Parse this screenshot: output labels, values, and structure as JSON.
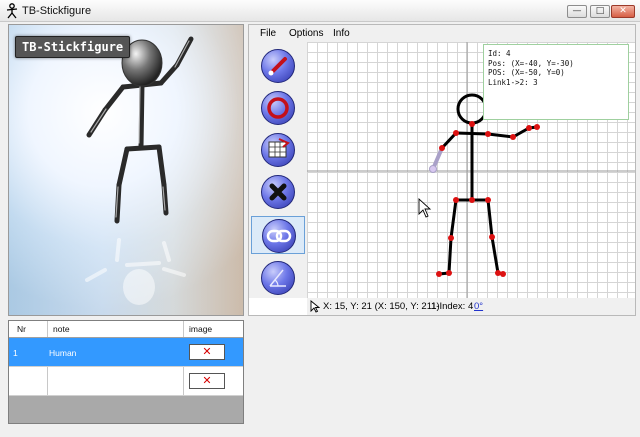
{
  "window": {
    "title": "TB-Stickfigure",
    "minimize_glyph": "—",
    "maximize_glyph": "□",
    "close_glyph": "✕"
  },
  "photo": {
    "label": "TB-Stickfigure"
  },
  "menu": [
    "File",
    "Options",
    "Info"
  ],
  "tools": [
    {
      "name": "line-tool-icon"
    },
    {
      "name": "circle-tool-icon"
    },
    {
      "name": "grid-copy-tool-icon"
    },
    {
      "name": "delete-tool-icon"
    },
    {
      "name": "link-tool-icon",
      "active": true
    },
    {
      "name": "angle-tool-icon"
    }
  ],
  "info_box": {
    "line1": "Id: 4",
    "line2": "Pos: (X=-40, Y=-30)",
    "line3": "POS: (X=-50, Y=0)",
    "line4": "Link1->2: 3"
  },
  "status": {
    "coords": "X: 15, Y: 21 (X: 150, Y: 211)",
    "index": "1-Index: 4",
    "angle": "0°"
  },
  "table": {
    "headers": [
      "Nr",
      "note",
      "image"
    ],
    "rows": [
      {
        "nr": "1",
        "note": "Human",
        "image": "✕",
        "selected": true
      },
      {
        "nr": "",
        "note": "",
        "image": "✕",
        "selected": false
      }
    ]
  },
  "colors": {
    "selection": "#3399ff",
    "joint": "#dd1111",
    "grid_line": "#d5d5d5"
  }
}
